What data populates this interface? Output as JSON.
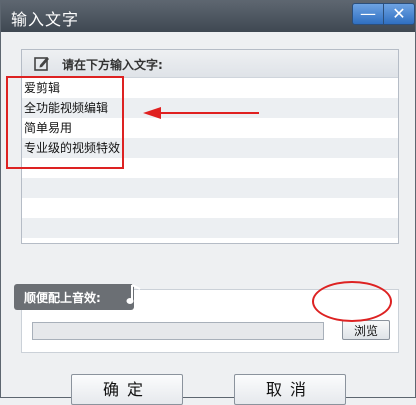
{
  "window": {
    "title": "输入文字"
  },
  "text_panel": {
    "header": "请在下方输入文字:",
    "lines": [
      "爱剪辑",
      "全功能视频编辑",
      "简单易用",
      "专业级的视频特效",
      "",
      "",
      "",
      "",
      ""
    ]
  },
  "audio_panel": {
    "label": "顺便配上音效:",
    "path_value": "",
    "browse_label": "浏览"
  },
  "buttons": {
    "ok": "确定",
    "cancel": "取消"
  }
}
